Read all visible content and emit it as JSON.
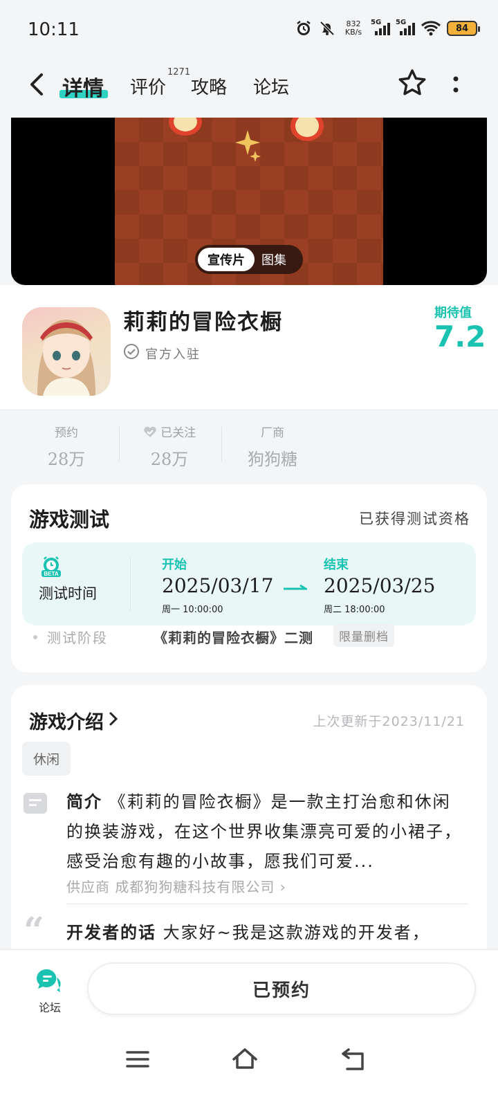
{
  "status_bar": {
    "time": "10:11",
    "net_speed_value": "832",
    "net_speed_unit": "KB/s",
    "sim1": "5G",
    "sim2": "5G",
    "battery": "84"
  },
  "nav": {
    "tabs": [
      {
        "label": "详情",
        "active": true
      },
      {
        "label": "评价",
        "badge": "1271"
      },
      {
        "label": "攻略"
      },
      {
        "label": "论坛"
      }
    ]
  },
  "media": {
    "toggle_active": "宣传片",
    "toggle_inactive": "图集"
  },
  "game": {
    "title": "莉莉的冒险衣橱",
    "verified": "官方入驻",
    "expect_label": "期待值",
    "expect_value": "7.2"
  },
  "stats": [
    {
      "label": "预约",
      "value": "28万"
    },
    {
      "label": "已关注",
      "value": "28万"
    },
    {
      "label": "厂商",
      "value": "狗狗糖"
    }
  ],
  "test_section": {
    "title": "游戏测试",
    "status": "已获得测试资格",
    "time_label": "测试时间",
    "beta_text": "BETA",
    "start_label": "开始",
    "start_date": "2025/03/17",
    "start_time": "周一  10:00:00",
    "end_label": "结束",
    "end_date": "2025/03/25",
    "end_time": "周二  18:00:00",
    "stage_label": "测试阶段",
    "stage_value": "《莉莉的冒险衣橱》二测",
    "stage_tag": "限量删档"
  },
  "intro_section": {
    "title": "游戏介绍",
    "updated": "上次更新于2023/11/21",
    "tag": "休闲",
    "desc_label": "简介",
    "desc_text": "《莉莉的冒险衣橱》是一款主打治愈和休闲的换装游戏，在这个世界收集漂亮可爱的小裙子，感受治愈有趣的小故事，愿我们可爱...",
    "supplier": "供应商 成都狗狗糖科技有限公司 ›",
    "dev_label": "开发者的话",
    "dev_text": "大家好~我是这款游戏的开发者，"
  },
  "bottom": {
    "forum_label": "论坛",
    "reserve_button": "已预约"
  },
  "colors": {
    "accent": "#19c2b1",
    "tab_underline": "#2ed1c2",
    "test_box_bg": "#e9f8f7"
  }
}
